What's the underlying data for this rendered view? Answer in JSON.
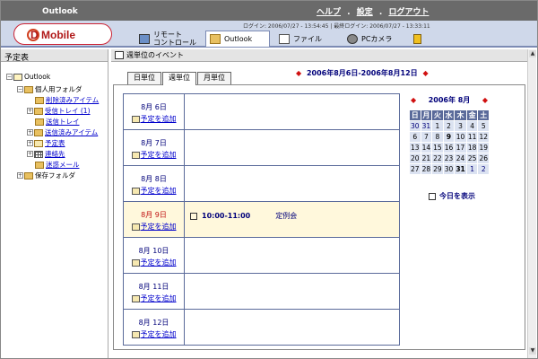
{
  "app": {
    "title": "Outlook",
    "logo_text": "D Mobile"
  },
  "top_menu": {
    "help": "ヘルプ",
    "settings": "設定",
    "logout": "ログアウト",
    "separator": ".",
    "login_info": "ログイン: 2006/07/27 - 13:54:45  |  最終ログイン: 2006/07/27 - 13:33:11"
  },
  "nav": {
    "remote": "リモート\nコントロール",
    "outlook": "Outlook",
    "file": "ファイル",
    "pc_camera": "PCカメラ"
  },
  "left": {
    "title": "予定表",
    "tree": {
      "root": "Outlook",
      "personal": "個人用フォルダ",
      "deleted": "削除済みアイテム",
      "inbox": "受信トレイ (1)",
      "outbox": "送信トレイ",
      "sent": "送信済みアイテム",
      "calendar": "予定表",
      "contacts": "連絡先",
      "junk": "迷惑メール",
      "archive": "保存フォルダ"
    }
  },
  "main": {
    "title": "週単位のイベント",
    "tabs": [
      "日単位",
      "週単位",
      "月単位"
    ],
    "date_range": "2006年8月6日-2006年8月12日",
    "add_label": "予定を追加",
    "days": [
      {
        "label": "8月 6日",
        "events": []
      },
      {
        "label": "8月 7日",
        "events": []
      },
      {
        "label": "8月 8日",
        "events": []
      },
      {
        "label": "8月 9日",
        "events": [
          {
            "time": "10:00-11:00",
            "title": "定例会"
          }
        ],
        "today": true
      },
      {
        "label": "8月 10日",
        "events": []
      },
      {
        "label": "8月 11日",
        "events": []
      },
      {
        "label": "8月 12日",
        "events": []
      }
    ]
  },
  "mini_calendar": {
    "title": "2006年 8月",
    "weekdays": [
      "日",
      "月",
      "火",
      "水",
      "木",
      "金",
      "土"
    ],
    "weeks": [
      [
        "30",
        "31",
        "1",
        "2",
        "3",
        "4",
        "5"
      ],
      [
        "6",
        "7",
        "8",
        "9",
        "10",
        "11",
        "12"
      ],
      [
        "13",
        "14",
        "15",
        "16",
        "17",
        "18",
        "19"
      ],
      [
        "20",
        "21",
        "22",
        "23",
        "24",
        "25",
        "26"
      ],
      [
        "27",
        "28",
        "29",
        "30",
        "31",
        "1",
        "2"
      ]
    ],
    "today_link": "今日を表示"
  },
  "colors": {
    "header_gray": "#6a6a6a",
    "nav_blue": "#cfd8ea",
    "table_border": "#5a6a9a",
    "today_row": "#fff8dc",
    "accent_red": "#d01010"
  }
}
